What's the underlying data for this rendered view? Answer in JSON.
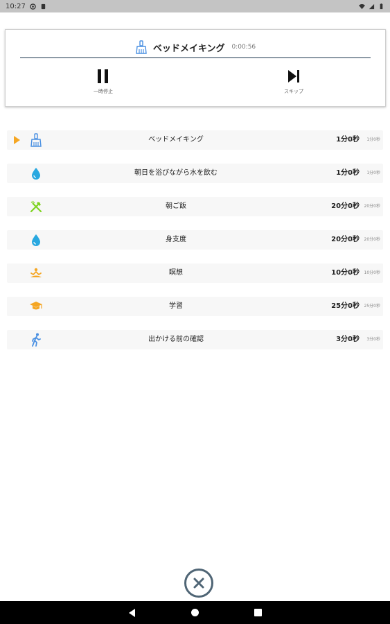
{
  "status_bar": {
    "time": "10:27",
    "icons": [
      "notification-icon",
      "sim-icon",
      "wifi-icon",
      "signal-icon",
      "battery-icon"
    ]
  },
  "player": {
    "title": "ベッドメイキング",
    "elapsed": "0:00:56",
    "title_icon": "broom-icon",
    "pause_label": "一時停止",
    "skip_label": "スキップ",
    "accent_color": "#4a90e2"
  },
  "tasks": [
    {
      "name": "ベッドメイキング",
      "duration": "1分0秒",
      "duration_small": "1分0秒",
      "icon": "broom-icon",
      "color": "#4a90e2",
      "active": true
    },
    {
      "name": "朝日を浴びながら水を飲む",
      "duration": "1分0秒",
      "duration_small": "1分0秒",
      "icon": "water-drop-icon",
      "color": "#29a8e0",
      "active": false
    },
    {
      "name": "朝ご飯",
      "duration": "20分0秒",
      "duration_small": "20分0秒",
      "icon": "fork-knife-icon",
      "color": "#7ed321",
      "active": false
    },
    {
      "name": "身支度",
      "duration": "20分0秒",
      "duration_small": "20分0秒",
      "icon": "water-drop-icon",
      "color": "#29a8e0",
      "active": false
    },
    {
      "name": "瞑想",
      "duration": "10分0秒",
      "duration_small": "10分0秒",
      "icon": "meditation-icon",
      "color": "#f5a623",
      "active": false
    },
    {
      "name": "学習",
      "duration": "25分0秒",
      "duration_small": "25分0秒",
      "icon": "graduation-cap-icon",
      "color": "#f5a623",
      "active": false
    },
    {
      "name": "出かける前の確認",
      "duration": "3分0秒",
      "duration_small": "3分0秒",
      "icon": "walking-icon",
      "color": "#4a90e2",
      "active": false
    }
  ],
  "close_button": {
    "icon": "close-icon",
    "color": "#4f6575"
  },
  "nav": {
    "icons": [
      "back-icon",
      "home-icon",
      "recents-icon"
    ]
  }
}
